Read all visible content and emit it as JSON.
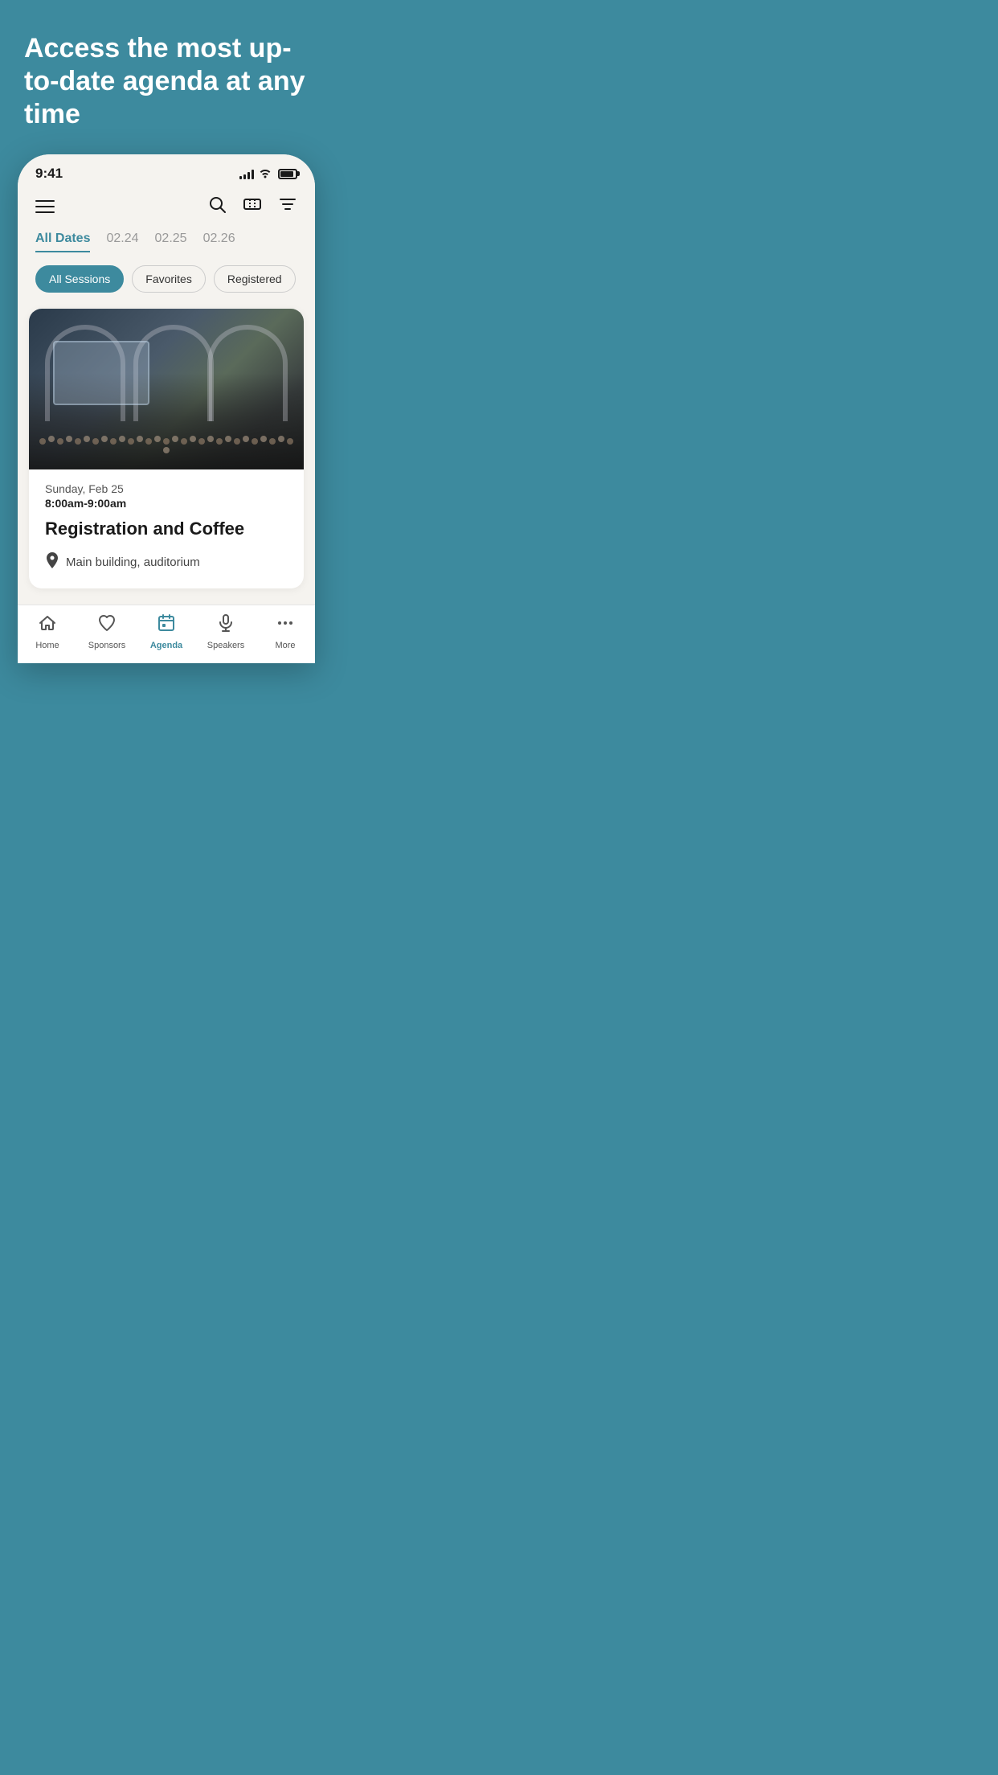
{
  "hero": {
    "text": "Access the most up-to-date agenda at any time"
  },
  "statusBar": {
    "time": "9:41"
  },
  "topNav": {
    "searchLabel": "Search",
    "ticketLabel": "Ticket",
    "filterLabel": "Filter"
  },
  "dateTabs": [
    {
      "label": "All Dates",
      "active": true
    },
    {
      "label": "02.24",
      "active": false
    },
    {
      "label": "02.25",
      "active": false
    },
    {
      "label": "02.26",
      "active": false
    }
  ],
  "sessionFilters": [
    {
      "label": "All Sessions",
      "active": true
    },
    {
      "label": "Favorites",
      "active": false
    },
    {
      "label": "Registered",
      "active": false
    }
  ],
  "sessionCard": {
    "date": "Sunday, Feb 25",
    "time": "8:00am-9:00am",
    "title": "Registration and Coffee",
    "location": "Main building, auditorium"
  },
  "bottomNav": [
    {
      "label": "Home",
      "icon": "home",
      "active": false
    },
    {
      "label": "Sponsors",
      "icon": "heart",
      "active": false
    },
    {
      "label": "Agenda",
      "icon": "calendar",
      "active": true
    },
    {
      "label": "Speakers",
      "icon": "mic",
      "active": false
    },
    {
      "label": "More",
      "icon": "dots",
      "active": false
    }
  ]
}
